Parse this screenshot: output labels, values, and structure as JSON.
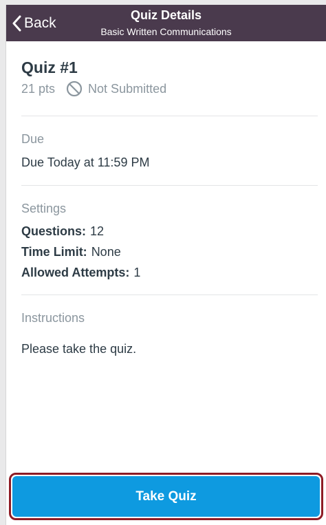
{
  "colors": {
    "nav_bg": "#4a3a4d",
    "accent": "#0e9ae0",
    "highlight_border": "#8e1b24",
    "text_primary": "#2d3b45",
    "text_secondary": "#8b969e"
  },
  "navbar": {
    "back_label": "Back",
    "back_icon": "chevron-left-icon",
    "title": "Quiz Details",
    "subtitle": "Basic Written Communications"
  },
  "quiz": {
    "title": "Quiz #1",
    "points": "21 pts",
    "status_icon": "not-submitted-icon",
    "status": "Not Submitted"
  },
  "due": {
    "label": "Due",
    "value": "Due Today at 11:59 PM"
  },
  "settings": {
    "label": "Settings",
    "items": [
      {
        "key": "Questions:",
        "value": "12"
      },
      {
        "key": "Time Limit:",
        "value": "None"
      },
      {
        "key": "Allowed Attempts:",
        "value": "1"
      }
    ]
  },
  "instructions": {
    "label": "Instructions",
    "text": "Please take the quiz."
  },
  "actions": {
    "take_quiz_label": "Take Quiz"
  }
}
